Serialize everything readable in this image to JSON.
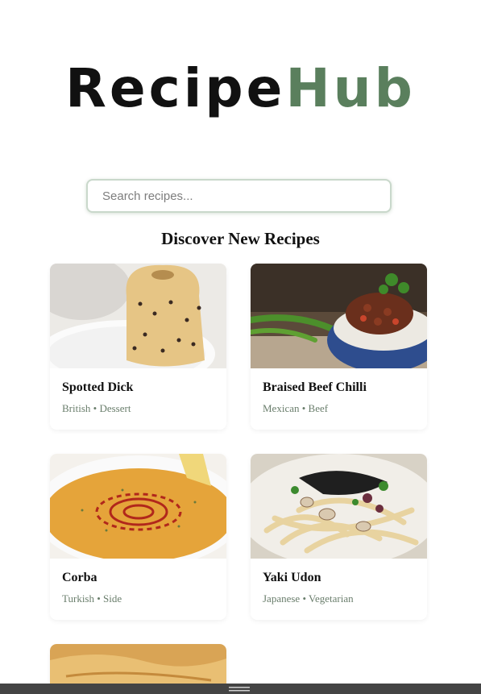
{
  "logo": {
    "part1": "Recipe",
    "part2": "Hub"
  },
  "search": {
    "placeholder": "Search recipes..."
  },
  "heading": "Discover New Recipes",
  "recipes": [
    {
      "title": "Spotted Dick",
      "cuisine": "British",
      "category": "Dessert"
    },
    {
      "title": "Braised Beef Chilli",
      "cuisine": "Mexican",
      "category": "Beef"
    },
    {
      "title": "Corba",
      "cuisine": "Turkish",
      "category": "Side"
    },
    {
      "title": "Yaki Udon",
      "cuisine": "Japanese",
      "category": "Vegetarian"
    }
  ],
  "separator": "•",
  "colors": {
    "brand_green": "#5a7f5d",
    "text": "#111111",
    "meta": "#6a7e6c"
  }
}
